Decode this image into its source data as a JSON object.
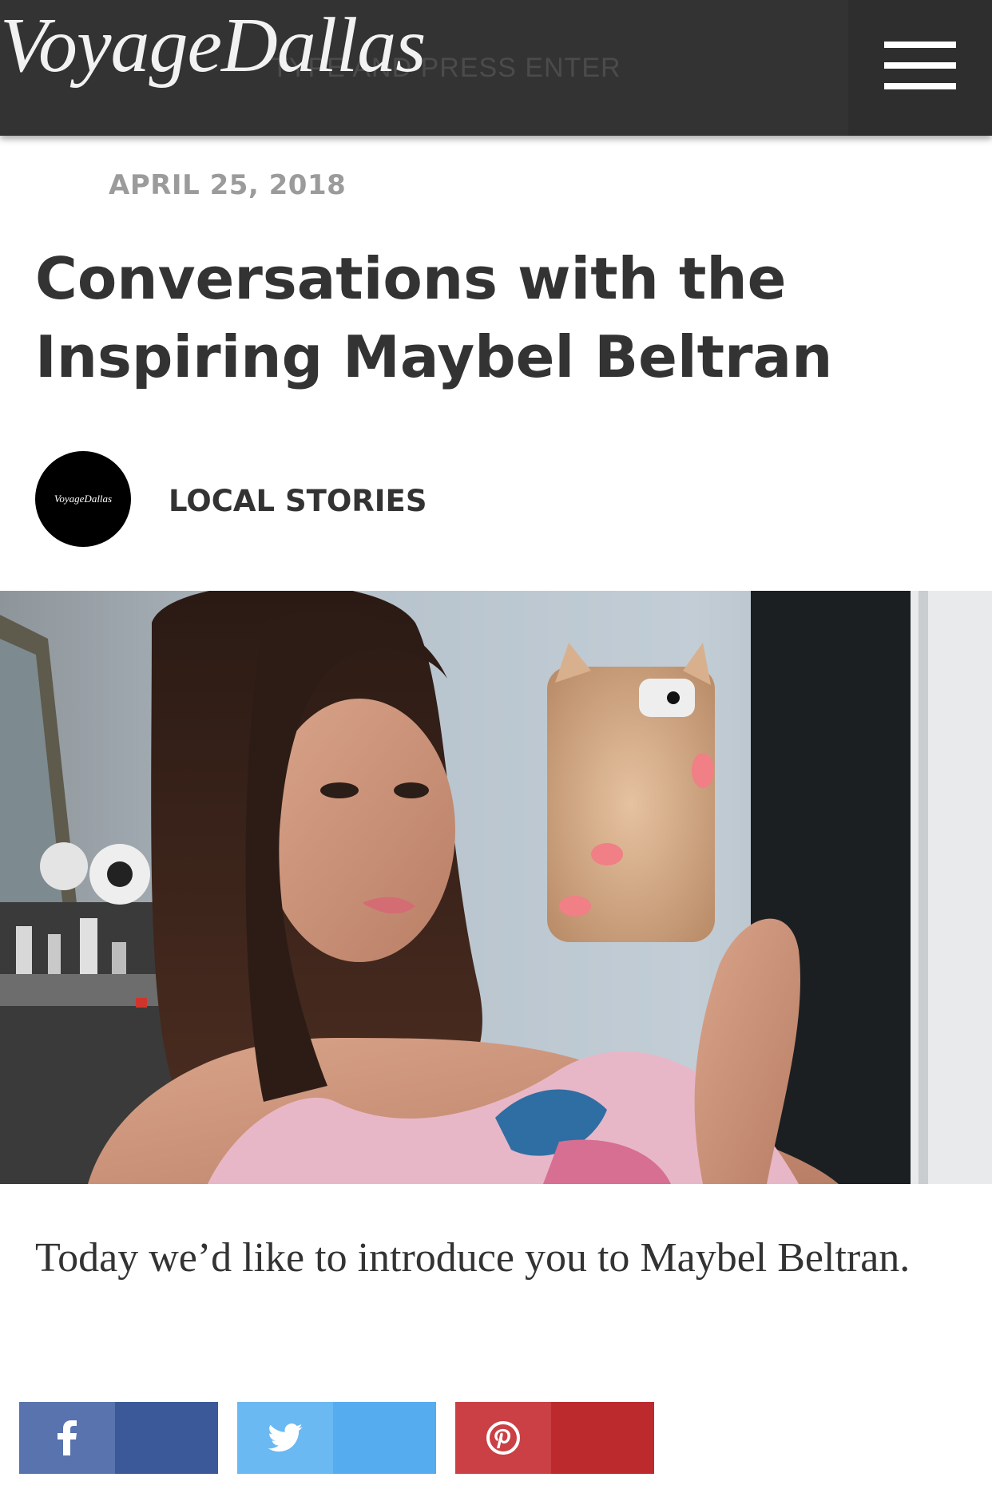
{
  "header": {
    "logo_text": "VoyageDallas",
    "search_hint": "TYPE AND PRESS ENTER",
    "menu_icon": "hamburger-menu-icon",
    "background_color": "#333333"
  },
  "article": {
    "date": "APRIL 25, 2018",
    "title": "Conversations with the Inspiring Maybel Beltran",
    "author_avatar_text": "VoyageDallas",
    "category": "LOCAL STORIES",
    "intro": "Today we’d like to introduce you to Maybel Beltran."
  },
  "share": {
    "buttons": [
      {
        "icon": "facebook-icon",
        "color": "#3b5998"
      },
      {
        "icon": "twitter-icon",
        "color": "#55acee"
      },
      {
        "icon": "pinterest-icon",
        "color": "#bd2a2e"
      }
    ]
  }
}
